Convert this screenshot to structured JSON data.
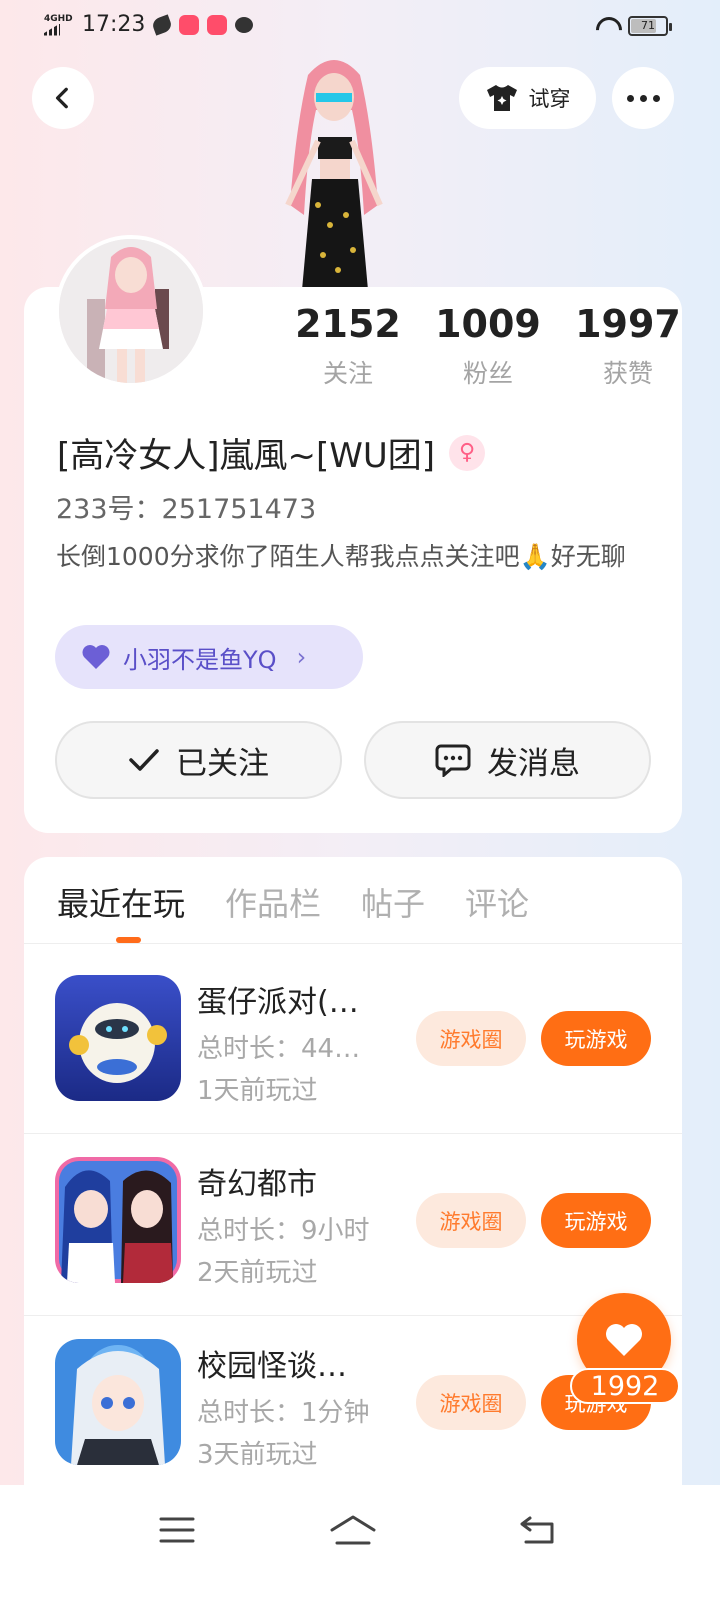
{
  "status_bar": {
    "network": "4GHD",
    "time": "17:23",
    "battery": "71"
  },
  "header": {
    "tryon_label": "试穿"
  },
  "profile": {
    "stats": [
      {
        "value": "2152",
        "label": "关注"
      },
      {
        "value": "1009",
        "label": "粉丝"
      },
      {
        "value": "1997",
        "label": "获赞"
      }
    ],
    "username": "[高冷女人]嵐風~[WU团]",
    "gender_symbol": "♀",
    "id_line": "233号：251751473",
    "bio": "长倒1000分求你了陌生人帮我点点关注吧🙏好无聊",
    "partner_name": "小羽不是鱼YQ",
    "follow_label": "已关注",
    "message_label": "发消息"
  },
  "tabs": [
    {
      "label": "最近在玩"
    },
    {
      "label": "作品栏"
    },
    {
      "label": "帖子"
    },
    {
      "label": "评论"
    }
  ],
  "games": [
    {
      "title": "蛋仔派对(…",
      "playtime": "总时长：44…",
      "last_played": "1天前玩过",
      "circle_label": "游戏圈",
      "play_label": "玩游戏"
    },
    {
      "title": "奇幻都市",
      "playtime": "总时长：9小时",
      "last_played": "2天前玩过",
      "circle_label": "游戏圈",
      "play_label": "玩游戏"
    },
    {
      "title": "校园怪谈…",
      "playtime": "总时长：1分钟",
      "last_played": "3天前玩过",
      "circle_label": "游戏圈",
      "play_label": "玩游戏"
    }
  ],
  "likes": {
    "count": "1992"
  },
  "colors": {
    "accent": "#ff6e14",
    "partner_bg": "#e6e3fb",
    "circle_bg": "#fde9dd"
  }
}
